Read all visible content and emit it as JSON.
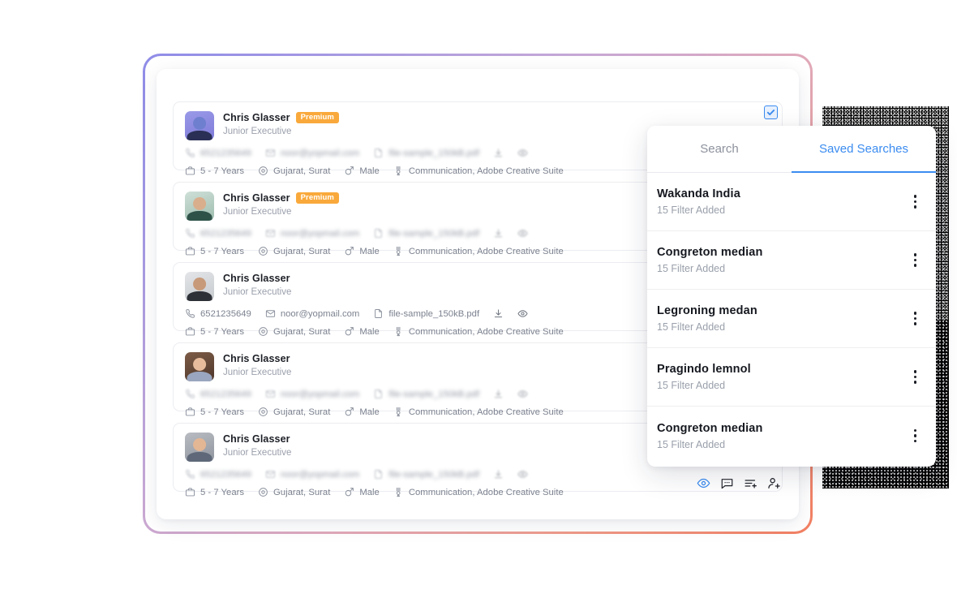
{
  "theme": {
    "accent_blue": "#3b8cf0",
    "badge_orange": "#f9a93b",
    "gradient_start": "#8f8ce8",
    "gradient_end": "#f28062",
    "text_dark": "#1c1f26",
    "text_muted": "#9a9fab"
  },
  "main_card": {
    "select_all_checkbox": {
      "checked": true,
      "icon": "check-icon"
    },
    "people": [
      {
        "name": "Chris Glasser",
        "badge": "Premium",
        "role": "Junior Executive",
        "phone": "6521235649",
        "email": "noor@yopmail.com",
        "file": "file-sample_150kB.pdf",
        "experience": "5 - 7 Years",
        "location": "Gujarat, Surat",
        "gender": "Male",
        "skills": "Communication, Adobe Creative Suite",
        "blurred": true,
        "avatar": "av0"
      },
      {
        "name": "Chris Glasser",
        "badge": "Premium",
        "role": "Junior Executive",
        "phone": "6521235649",
        "email": "noor@yopmail.com",
        "file": "file-sample_150kB.pdf",
        "experience": "5 - 7 Years",
        "location": "Gujarat, Surat",
        "gender": "Male",
        "skills": "Communication, Adobe Creative Suite",
        "blurred": true,
        "avatar": "av1"
      },
      {
        "name": "Chris Glasser",
        "badge": "",
        "role": "Junior Executive",
        "phone": "6521235649",
        "email": "noor@yopmail.com",
        "file": "file-sample_150kB.pdf",
        "experience": "5 - 7 Years",
        "location": "Gujarat, Surat",
        "gender": "Male",
        "skills": "Communication, Adobe Creative Suite",
        "blurred": false,
        "avatar": "av2"
      },
      {
        "name": "Chris Glasser",
        "badge": "",
        "role": "Junior Executive",
        "phone": "6521235649",
        "email": "noor@yopmail.com",
        "file": "file-sample_150kB.pdf",
        "experience": "5 - 7 Years",
        "location": "Gujarat, Surat",
        "gender": "Male",
        "skills": "Communication, Adobe Creative Suite",
        "blurred": true,
        "avatar": "av3"
      },
      {
        "name": "Chris Glasser",
        "badge": "",
        "role": "Junior Executive",
        "phone": "6521235649",
        "email": "noor@yopmail.com",
        "file": "file-sample_150kB.pdf",
        "experience": "5 - 7 Years",
        "location": "Gujarat, Surat",
        "gender": "Male",
        "skills": "Communication, Adobe Creative Suite",
        "blurred": true,
        "avatar": "av4"
      }
    ],
    "action_icons": [
      {
        "name": "eye-icon",
        "active": true
      },
      {
        "name": "comment-icon",
        "active": false
      },
      {
        "name": "add-to-list-icon",
        "active": false
      },
      {
        "name": "add-user-icon",
        "active": false
      }
    ]
  },
  "panel": {
    "tabs": [
      {
        "label": "Search",
        "active": false
      },
      {
        "label": "Saved Searches",
        "active": true
      }
    ],
    "saved_searches": [
      {
        "title": "Wakanda India",
        "subtitle": "15 Filter Added"
      },
      {
        "title": "Congreton median",
        "subtitle": "15 Filter Added"
      },
      {
        "title": "Legroning medan",
        "subtitle": "15 Filter Added"
      },
      {
        "title": "Pragindo lemnol",
        "subtitle": "15 Filter Added"
      },
      {
        "title": "Congreton median",
        "subtitle": "15 Filter Added"
      }
    ]
  }
}
